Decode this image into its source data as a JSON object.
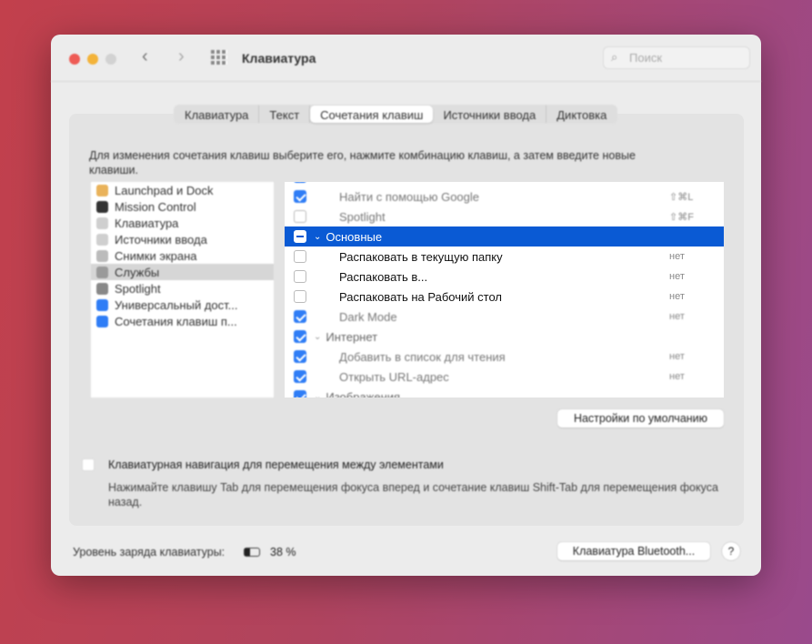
{
  "window": {
    "title": "Клавиатура",
    "search_placeholder": "Поиск"
  },
  "tabs": [
    "Клавиатура",
    "Текст",
    "Сочетания клавиш",
    "Источники ввода",
    "Диктовка"
  ],
  "active_tab": 2,
  "description": "Для изменения сочетания клавиш выберите его, нажмите комбинацию клавиш, а затем введите новые клавиши.",
  "categories": [
    {
      "label": "Launchpad и Dock",
      "color": "#e9b25a"
    },
    {
      "label": "Mission Control",
      "color": "#333333"
    },
    {
      "label": "Клавиатура",
      "color": "#cfcfcf"
    },
    {
      "label": "Источники ввода",
      "color": "#cfcfcf"
    },
    {
      "label": "Снимки экрана",
      "color": "#bbbbbb"
    },
    {
      "label": "Службы",
      "color": "#9a9a9a"
    },
    {
      "label": "Spotlight",
      "color": "#888888"
    },
    {
      "label": "Универсальный дост...",
      "color": "#2f7df6"
    },
    {
      "label": "Сочетания клавиш п...",
      "color": "#2f7df6"
    }
  ],
  "selected_category": 5,
  "shortcuts": [
    {
      "type": "item",
      "label": "Найти с помощью Google",
      "key": "⇧⌘L",
      "checked": true
    },
    {
      "type": "item",
      "label": "Spotlight",
      "key": "⇧⌘F",
      "checked": false
    },
    {
      "type": "group",
      "label": "Основные",
      "state": "mixed",
      "selected": true
    },
    {
      "type": "item",
      "label": "Распаковать в текущую папку",
      "key": "нет",
      "checked": false
    },
    {
      "type": "item",
      "label": "Распаковать в...",
      "key": "нет",
      "checked": false
    },
    {
      "type": "item",
      "label": "Распаковать на Рабочий стол",
      "key": "нет",
      "checked": false
    },
    {
      "type": "item",
      "label": "Dark Mode",
      "key": "нет",
      "checked": true
    },
    {
      "type": "group",
      "label": "Интернет",
      "state": "checked"
    },
    {
      "type": "item",
      "label": "Добавить в список для чтения",
      "key": "нет",
      "checked": true
    },
    {
      "type": "item",
      "label": "Открыть URL-адрес",
      "key": "нет",
      "checked": true
    },
    {
      "type": "group",
      "label": "Изображения",
      "state": "checked"
    }
  ],
  "restore_defaults": "Настройки по умолчанию",
  "keyboard_nav": {
    "label": "Клавиатурная навигация для перемещения между элементами",
    "checked": false,
    "hint": "Нажимайте клавишу Tab для перемещения фокуса вперед и сочетание клавиш Shift-Tab для перемещения фокуса назад."
  },
  "battery": {
    "label": "Уровень заряда клавиатуры:",
    "value": "38 %",
    "percent": 38
  },
  "bluetooth_button": "Клавиатура Bluetooth...",
  "help": "?"
}
